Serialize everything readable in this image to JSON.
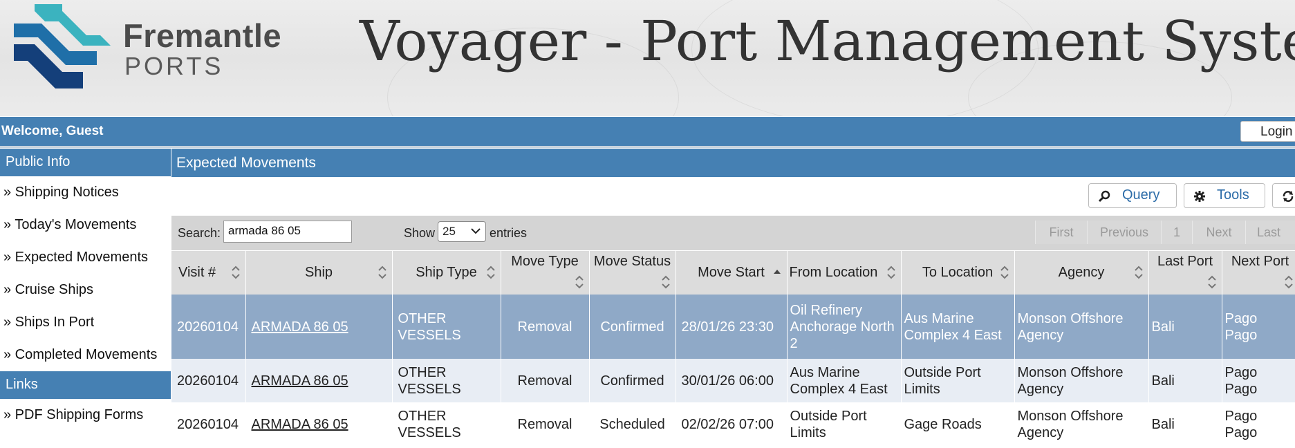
{
  "banner": {
    "logo_word": "Fremantle",
    "logo_sub": "PORTS",
    "title": "Voyager - Port Management System"
  },
  "welcome": {
    "text": "Welcome, Guest",
    "login_label": "Login"
  },
  "sidebar": {
    "public_header": "Public Info",
    "items": [
      "» Shipping Notices",
      "» Today's Movements",
      "» Expected Movements",
      "» Cruise Ships",
      "» Ships In Port",
      "» Completed Movements"
    ],
    "links_header": "Links",
    "links": [
      "» PDF Shipping Forms"
    ]
  },
  "main": {
    "title": "Expected Movements",
    "toolbar": {
      "query": "Query",
      "tools": "Tools"
    },
    "search": {
      "label": "Search:",
      "value": "armada 86 05"
    },
    "show": {
      "label": "Show",
      "value": "25",
      "suffix": "entries"
    },
    "pager": {
      "first": "First",
      "previous": "Previous",
      "page": "1",
      "next": "Next",
      "last": "Last"
    },
    "columns": [
      "Visit #",
      "Ship",
      "Ship Type",
      "Move Type",
      "Move Status",
      "Move Start",
      "From Location",
      "To Location",
      "Agency",
      "Last Port",
      "Next Port"
    ],
    "rows": [
      [
        "20260104",
        "ARMADA 86 05",
        "OTHER VESSELS",
        "Removal",
        "Confirmed",
        "28/01/26 23:30",
        "Oil Refinery Anchorage North 2",
        "Aus Marine Complex 4 East",
        "Monson Offshore Agency",
        "Bali",
        "Pago Pago"
      ],
      [
        "20260104",
        "ARMADA 86 05",
        "OTHER VESSELS",
        "Removal",
        "Confirmed",
        "30/01/26 06:00",
        "Aus Marine Complex 4 East",
        "Outside Port Limits",
        "Monson Offshore Agency",
        "Bali",
        "Pago Pago"
      ],
      [
        "20260104",
        "ARMADA 86 05",
        "OTHER VESSELS",
        "Removal",
        "Scheduled",
        "02/02/26 07:00",
        "Outside Port Limits",
        "Gage Roads",
        "Monson Offshore Agency",
        "Bali",
        "Pago Pago"
      ]
    ]
  },
  "colors": {
    "header_blue": "#4580b3",
    "selected_row": "#8fa9c7",
    "alt_row": "#e8edf4",
    "link_blue": "#2c6ca8"
  },
  "icons": [
    "search-icon",
    "gear-icon",
    "refresh-icon",
    "sort-icon",
    "chevron-down-icon"
  ]
}
